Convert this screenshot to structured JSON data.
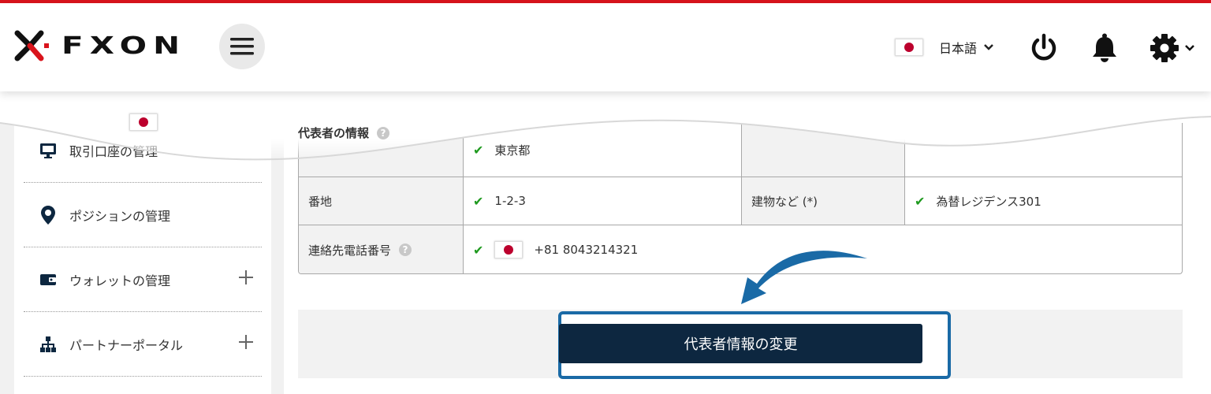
{
  "header": {
    "logo_text": "FXON",
    "language": "日本語",
    "icons": [
      "hamburger-menu-icon",
      "japan-flag-icon",
      "chevron-down-icon",
      "power-icon",
      "bell-icon",
      "gear-icon"
    ]
  },
  "sidebar": {
    "items": [
      {
        "label": "取引口座の管理",
        "icon": "monitor-icon",
        "expandable": false
      },
      {
        "label": "ポジションの管理",
        "icon": "location-pin-icon",
        "expandable": false
      },
      {
        "label": "ウォレットの管理",
        "icon": "wallet-icon",
        "expandable": true
      },
      {
        "label": "パートナーポータル",
        "icon": "sitemap-icon",
        "expandable": true
      }
    ]
  },
  "section": {
    "title": "代表者の情報",
    "rows": [
      {
        "label": "",
        "value": "東京都",
        "label2": "",
        "value2": ""
      },
      {
        "label": "番地",
        "value": "1-2-3",
        "label2": "建物など (*)",
        "value2": "為替レジデンス301"
      },
      {
        "label": "連絡先電話番号",
        "value": "+81 8043214321"
      }
    ]
  },
  "actions": {
    "change_button": "代表者情報の変更"
  },
  "colors": {
    "accent_red": "#d9141c",
    "navy": "#0d2740",
    "highlight_blue": "#1a6aa6",
    "check_green": "#1f9a1f"
  }
}
